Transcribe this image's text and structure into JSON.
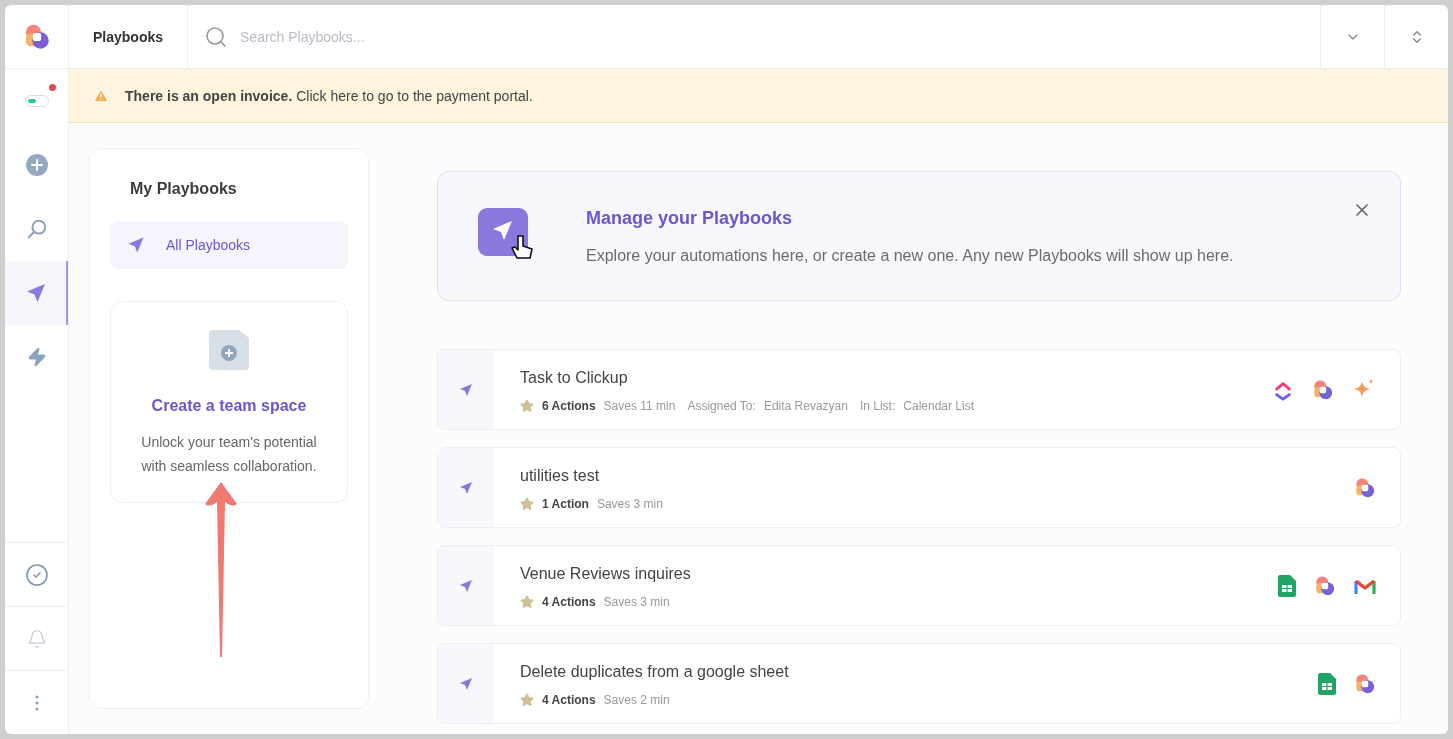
{
  "header": {
    "title": "Playbooks",
    "search": {
      "placeholder": "Search Playbooks..."
    }
  },
  "banner": {
    "text": "**There is an open invoice.** Click here to go to the payment portal."
  },
  "rail": {
    "top": [
      {
        "kind": "toggle",
        "selected": false,
        "alert": true
      },
      {
        "kind": "plus",
        "selected": false
      },
      {
        "kind": "search",
        "selected": false
      },
      {
        "kind": "send",
        "selected": true
      },
      {
        "kind": "bolt",
        "selected": false
      }
    ],
    "bottom": [
      {
        "kind": "check",
        "selected": false
      },
      {
        "kind": "bell",
        "selected": false
      },
      {
        "kind": "dots",
        "selected": false
      }
    ]
  },
  "sidebar": {
    "title": "My Playbooks",
    "items": [
      {
        "label": "All Playbooks",
        "selected": true
      }
    ],
    "team_card": {
      "title": "Create a team space",
      "text": "Unlock your team's potential with seamless collaboration."
    }
  },
  "promo": {
    "title": "Manage your Playbooks",
    "text": "Explore your automations here, or create a new one. Any new Playbooks will show up here."
  },
  "playbooks": [
    {
      "name": "Task to Clickup",
      "actions": "6 Actions",
      "saves": "Saves 11 min",
      "meta": [
        {
          "label": "Assigned To:",
          "value": "Edita Revazyan"
        },
        {
          "label": "In List:",
          "value": "Calendar List"
        }
      ],
      "apps": [
        {
          "kind": "chevrons"
        },
        {
          "kind": "blob"
        },
        {
          "kind": "sparkle"
        }
      ]
    },
    {
      "name": "utilities test",
      "actions": "1 Action",
      "saves": "Saves 3 min",
      "apps": [
        {
          "kind": "blob"
        }
      ]
    },
    {
      "name": "Venue Reviews inquires",
      "actions": "4 Actions",
      "saves": "Saves 3 min",
      "apps": [
        {
          "kind": "sheet"
        },
        {
          "kind": "blob"
        },
        {
          "kind": "mail"
        }
      ]
    },
    {
      "name": "Delete duplicates from a google sheet",
      "actions": "4 Actions",
      "saves": "Saves 2 min",
      "apps": [
        {
          "kind": "sheet"
        },
        {
          "kind": "blob"
        }
      ]
    }
  ]
}
